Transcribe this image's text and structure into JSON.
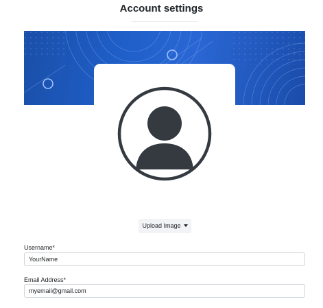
{
  "page": {
    "title": "Account settings"
  },
  "colors": {
    "banner": "#1f5fc9",
    "avatar": "#343a40",
    "input_border": "#ced4da"
  },
  "avatar": {
    "icon": "user-avatar-icon"
  },
  "upload": {
    "label": "Upload Image",
    "icon": "caret-down-icon"
  },
  "form": {
    "username": {
      "label": "Username*",
      "value": "YourName"
    },
    "email": {
      "label": "Email Address*",
      "value": "myemail@gmail.com"
    }
  }
}
